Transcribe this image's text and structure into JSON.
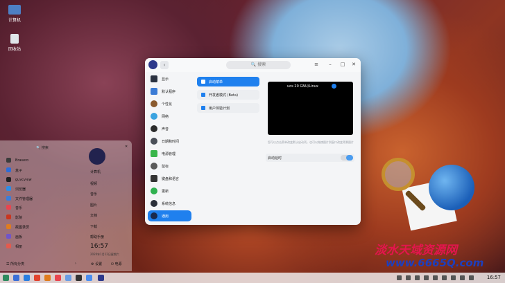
{
  "desktop": {
    "icons": [
      {
        "label": "计算机",
        "icon": "computer-icon"
      },
      {
        "label": "回收站",
        "icon": "trash-icon"
      }
    ]
  },
  "settings": {
    "search_placeholder": "搜索",
    "nav": [
      {
        "label": "显示",
        "icon": "display-icon"
      },
      {
        "label": "默认程序",
        "icon": "default-apps-icon"
      },
      {
        "label": "个性化",
        "icon": "personalization-icon"
      },
      {
        "label": "网络",
        "icon": "network-icon"
      },
      {
        "label": "声音",
        "icon": "sound-icon"
      },
      {
        "label": "日期和时间",
        "icon": "clock-icon"
      },
      {
        "label": "电源管理",
        "icon": "battery-icon"
      },
      {
        "label": "鼠标",
        "icon": "mouse-icon"
      },
      {
        "label": "键盘和语言",
        "icon": "keyboard-icon"
      },
      {
        "label": "更新",
        "icon": "update-icon"
      },
      {
        "label": "系统信息",
        "icon": "info-icon"
      },
      {
        "label": "通用",
        "icon": "general-icon"
      }
    ],
    "active_nav": "通用",
    "sub": [
      {
        "label": "启动菜单",
        "icon": "boot-menu-icon"
      },
      {
        "label": "开发者模式 (Beta)",
        "icon": "developer-icon"
      },
      {
        "label": "用户体验计划",
        "icon": "ux-program-icon"
      }
    ],
    "boot_entry": "uos 20 GNU/Linux",
    "hint": "您可以点击菜单改变默认启动项，也可以拖拽图片到窗口改变背景图片",
    "boot_delay_label": "启动延时",
    "boot_delay_on": true
  },
  "launcher": {
    "search": "搜索",
    "apps": [
      {
        "label": "Brasero",
        "color": "#3c3c3c"
      },
      {
        "label": "盒子",
        "color": "#2d6dd8"
      },
      {
        "label": "guvcview",
        "color": "#222222"
      },
      {
        "label": "浏览器",
        "color": "#2f8de4"
      },
      {
        "label": "文件管理器",
        "color": "#3b7dd8"
      },
      {
        "label": "音乐",
        "color": "#e9454f"
      },
      {
        "label": "影院",
        "color": "#c9361f"
      },
      {
        "label": "截图录屏",
        "color": "#e07c1f"
      },
      {
        "label": "画板",
        "color": "#7055c9"
      },
      {
        "label": "相册",
        "color": "#e45a4d"
      }
    ],
    "all_categories": "所有分类",
    "user_name": "计算机",
    "quick_links": [
      "视频",
      "音乐",
      "图片",
      "文档",
      "下载",
      "帮助手册"
    ],
    "time": "16:57",
    "date": "2020年1月12日星期六",
    "settings_label": "设置",
    "power_label": "电源"
  },
  "taskbar": {
    "time": "16:57"
  },
  "watermark": {
    "text": "淡水天域资源网",
    "url": "www.6665Q.com"
  }
}
